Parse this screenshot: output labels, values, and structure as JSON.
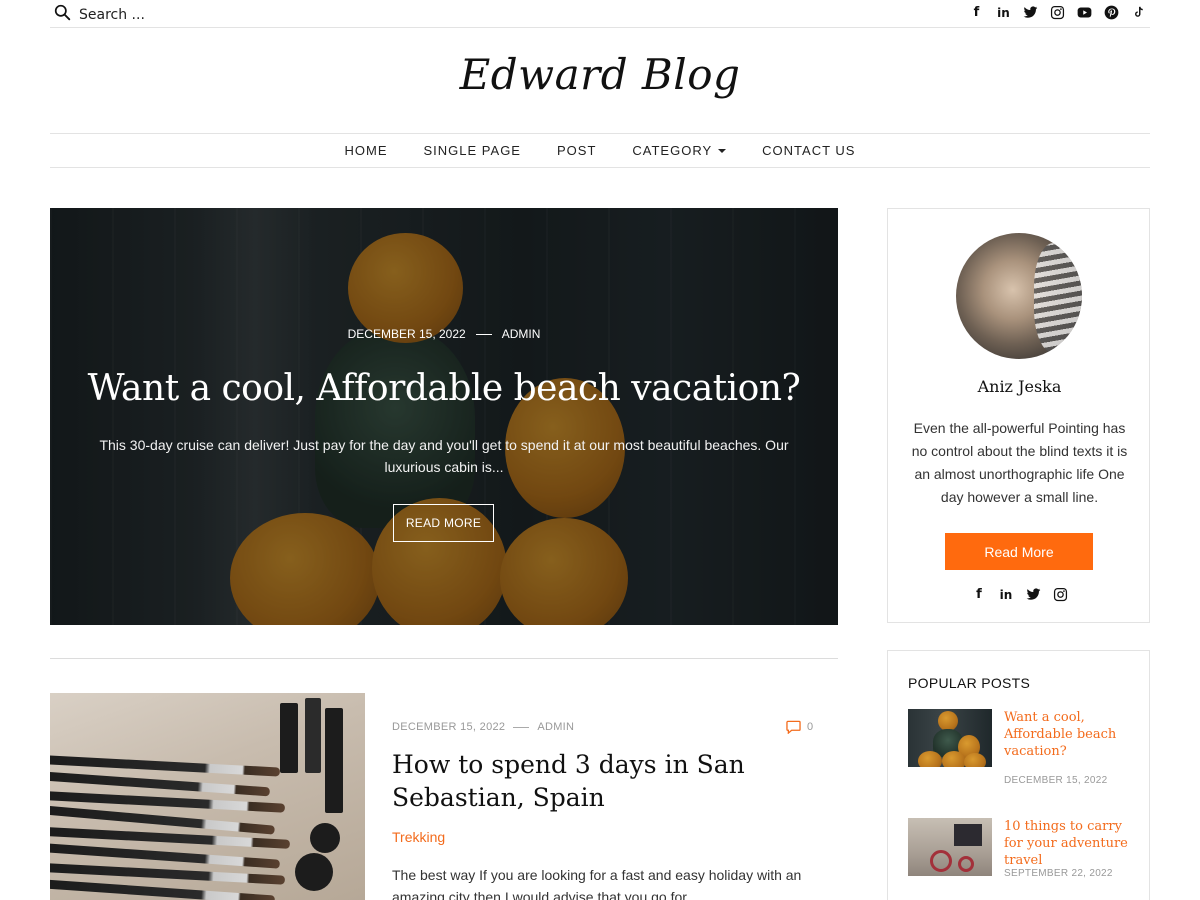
{
  "search": {
    "placeholder": "Search ..."
  },
  "social_top": [
    "facebook-icon",
    "linkedin-icon",
    "twitter-icon",
    "instagram-icon",
    "youtube-icon",
    "pinterest-icon",
    "tiktok-icon"
  ],
  "site": {
    "title": "Edward Blog"
  },
  "nav": {
    "home": "HOME",
    "single_page": "SINGLE PAGE",
    "post": "POST",
    "category": "CATEGORY",
    "contact": "CONTACT US"
  },
  "hero": {
    "date": "DECEMBER 15, 2022",
    "author": "ADMIN",
    "title": "Want a cool, Affordable beach vacation?",
    "excerpt": "This 30-day cruise can deliver! Just pay for the day and you'll get to spend it at our most beautiful beaches. Our luxurious cabin is...",
    "button": "READ MORE"
  },
  "post": {
    "date": "DECEMBER 15, 2022",
    "author": "ADMIN",
    "comments": "0",
    "title": "How to spend 3 days in San Sebastian, Spain",
    "category": "Trekking",
    "excerpt": "The best way If you are looking for a fast and easy holiday with an amazing city then I would advise that you go for"
  },
  "about": {
    "name": "Aniz Jeska",
    "text": "Even the all-powerful Pointing has no control about the blind texts it is an almost unorthographic life One day however a small line.",
    "button": "Read More",
    "social": [
      "facebook-icon",
      "linkedin-icon",
      "twitter-icon",
      "instagram-icon"
    ]
  },
  "popular": {
    "title": "POPULAR POSTS",
    "items": [
      {
        "title": "Want a cool, Affordable beach vacation?",
        "date": "DECEMBER 15, 2022"
      },
      {
        "title": "10 things to carry for your adventure travel",
        "date": "SEPTEMBER 22, 2022"
      }
    ]
  },
  "colors": {
    "accent": "#ff6a0e",
    "link": "#f36b1c",
    "text": "#222222",
    "border": "#e3e3e3"
  }
}
